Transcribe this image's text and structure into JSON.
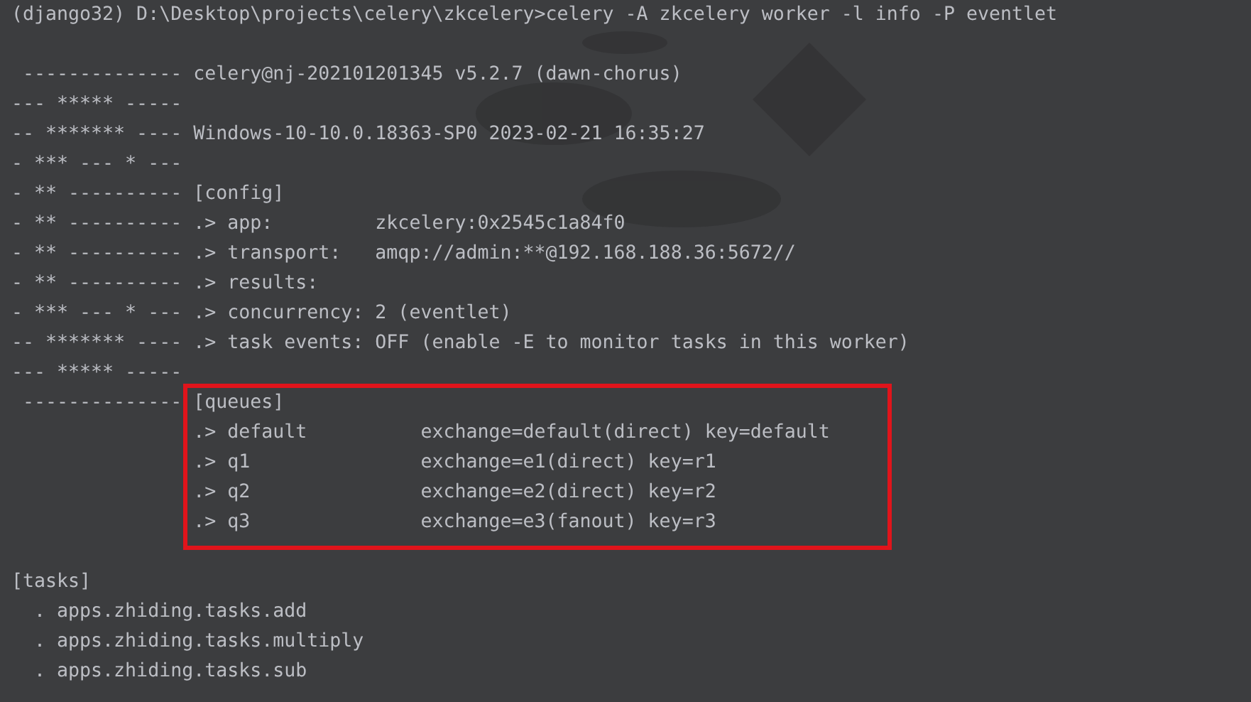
{
  "command": "(django32) D:\\Desktop\\projects\\celery\\zkcelery>celery -A zkcelery worker -l info -P eventlet",
  "banner": [
    " -------------- celery@nj-202101201345 v5.2.7 (dawn-chorus)",
    "--- ***** -----",
    "-- ******* ---- Windows-10-10.0.18363-SP0 2023-02-21 16:35:27",
    "- *** --- * ---",
    "- ** ---------- [config]",
    "- ** ---------- .> app:         zkcelery:0x2545c1a84f0",
    "- ** ---------- .> transport:   amqp://admin:**@192.168.188.36:5672//",
    "- ** ---------- .> results:",
    "- *** --- * --- .> concurrency: 2 (eventlet)",
    "-- ******* ---- .> task events: OFF (enable -E to monitor tasks in this worker)",
    "--- ***** -----"
  ],
  "queues": [
    " -------------- [queues]",
    "                .> default          exchange=default(direct) key=default",
    "                .> q1               exchange=e1(direct) key=r1",
    "                .> q2               exchange=e2(direct) key=r2",
    "                .> q3               exchange=e3(fanout) key=r3"
  ],
  "tasks": [
    "[tasks]",
    "  . apps.zhiding.tasks.add",
    "  . apps.zhiding.tasks.multiply",
    "  . apps.zhiding.tasks.sub"
  ]
}
